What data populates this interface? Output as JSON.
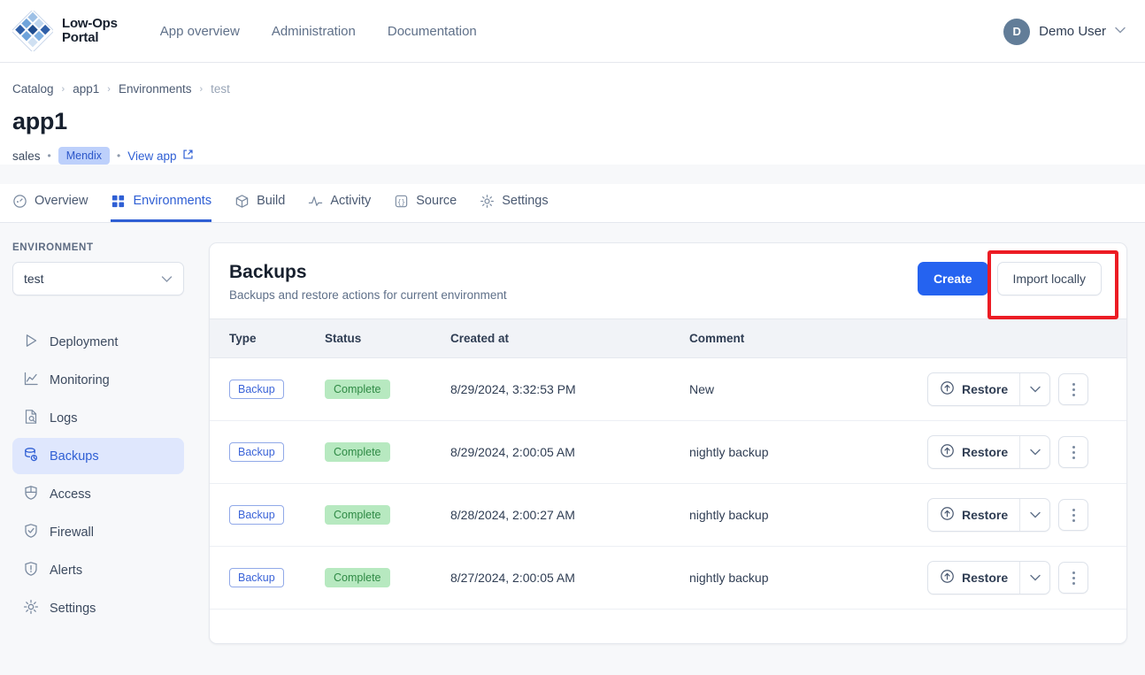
{
  "header": {
    "brand_line1": "Low-Ops",
    "brand_line2": "Portal",
    "logo_icon": "diamond-grid-logo",
    "nav": [
      {
        "label": "App overview",
        "name": "nav-app-overview"
      },
      {
        "label": "Administration",
        "name": "nav-administration"
      },
      {
        "label": "Documentation",
        "name": "nav-documentation"
      }
    ],
    "user": {
      "initial": "D",
      "name": "Demo User",
      "caret": "∨"
    }
  },
  "breadcrumb": {
    "items": [
      "Catalog",
      "app1",
      "Environments",
      "test"
    ],
    "separator": "›"
  },
  "page": {
    "title": "app1",
    "owner": "sales",
    "tech_badge": "Mendix",
    "view_app": "View app",
    "dot": "•"
  },
  "tabs": [
    {
      "label": "Overview",
      "icon": "gauge-icon",
      "active": false
    },
    {
      "label": "Environments",
      "icon": "grid-icon",
      "active": true
    },
    {
      "label": "Build",
      "icon": "box-icon",
      "active": false
    },
    {
      "label": "Activity",
      "icon": "pulse-icon",
      "active": false
    },
    {
      "label": "Source",
      "icon": "braces-icon",
      "active": false
    },
    {
      "label": "Settings",
      "icon": "gear-icon",
      "active": false
    }
  ],
  "sidebar": {
    "section_label": "ENVIRONMENT",
    "env_value": "test",
    "items": [
      {
        "label": "Deployment",
        "icon": "play-icon",
        "active": false
      },
      {
        "label": "Monitoring",
        "icon": "chart-line-icon",
        "active": false
      },
      {
        "label": "Logs",
        "icon": "document-search-icon",
        "active": false
      },
      {
        "label": "Backups",
        "icon": "database-sync-icon",
        "active": true
      },
      {
        "label": "Access",
        "icon": "shield-grid-icon",
        "active": false
      },
      {
        "label": "Firewall",
        "icon": "shield-check-icon",
        "active": false
      },
      {
        "label": "Alerts",
        "icon": "shield-alert-icon",
        "active": false
      },
      {
        "label": "Settings",
        "icon": "gear-icon",
        "active": false
      }
    ]
  },
  "card": {
    "title": "Backups",
    "subtitle": "Backups and restore actions for current environment",
    "create_label": "Create",
    "import_label": "Import locally",
    "highlight_color": "#ec1c24"
  },
  "table": {
    "columns": [
      "Type",
      "Status",
      "Created at",
      "Comment",
      ""
    ],
    "rows": [
      {
        "type": "Backup",
        "status": "Complete",
        "created_at": "8/29/2024, 3:32:53 PM",
        "comment": "New",
        "action": "Restore"
      },
      {
        "type": "Backup",
        "status": "Complete",
        "created_at": "8/29/2024, 2:00:05 AM",
        "comment": "nightly backup",
        "action": "Restore"
      },
      {
        "type": "Backup",
        "status": "Complete",
        "created_at": "8/28/2024, 2:00:27 AM",
        "comment": "nightly backup",
        "action": "Restore"
      },
      {
        "type": "Backup",
        "status": "Complete",
        "created_at": "8/27/2024, 2:00:05 AM",
        "comment": "nightly backup",
        "action": "Restore"
      }
    ]
  }
}
